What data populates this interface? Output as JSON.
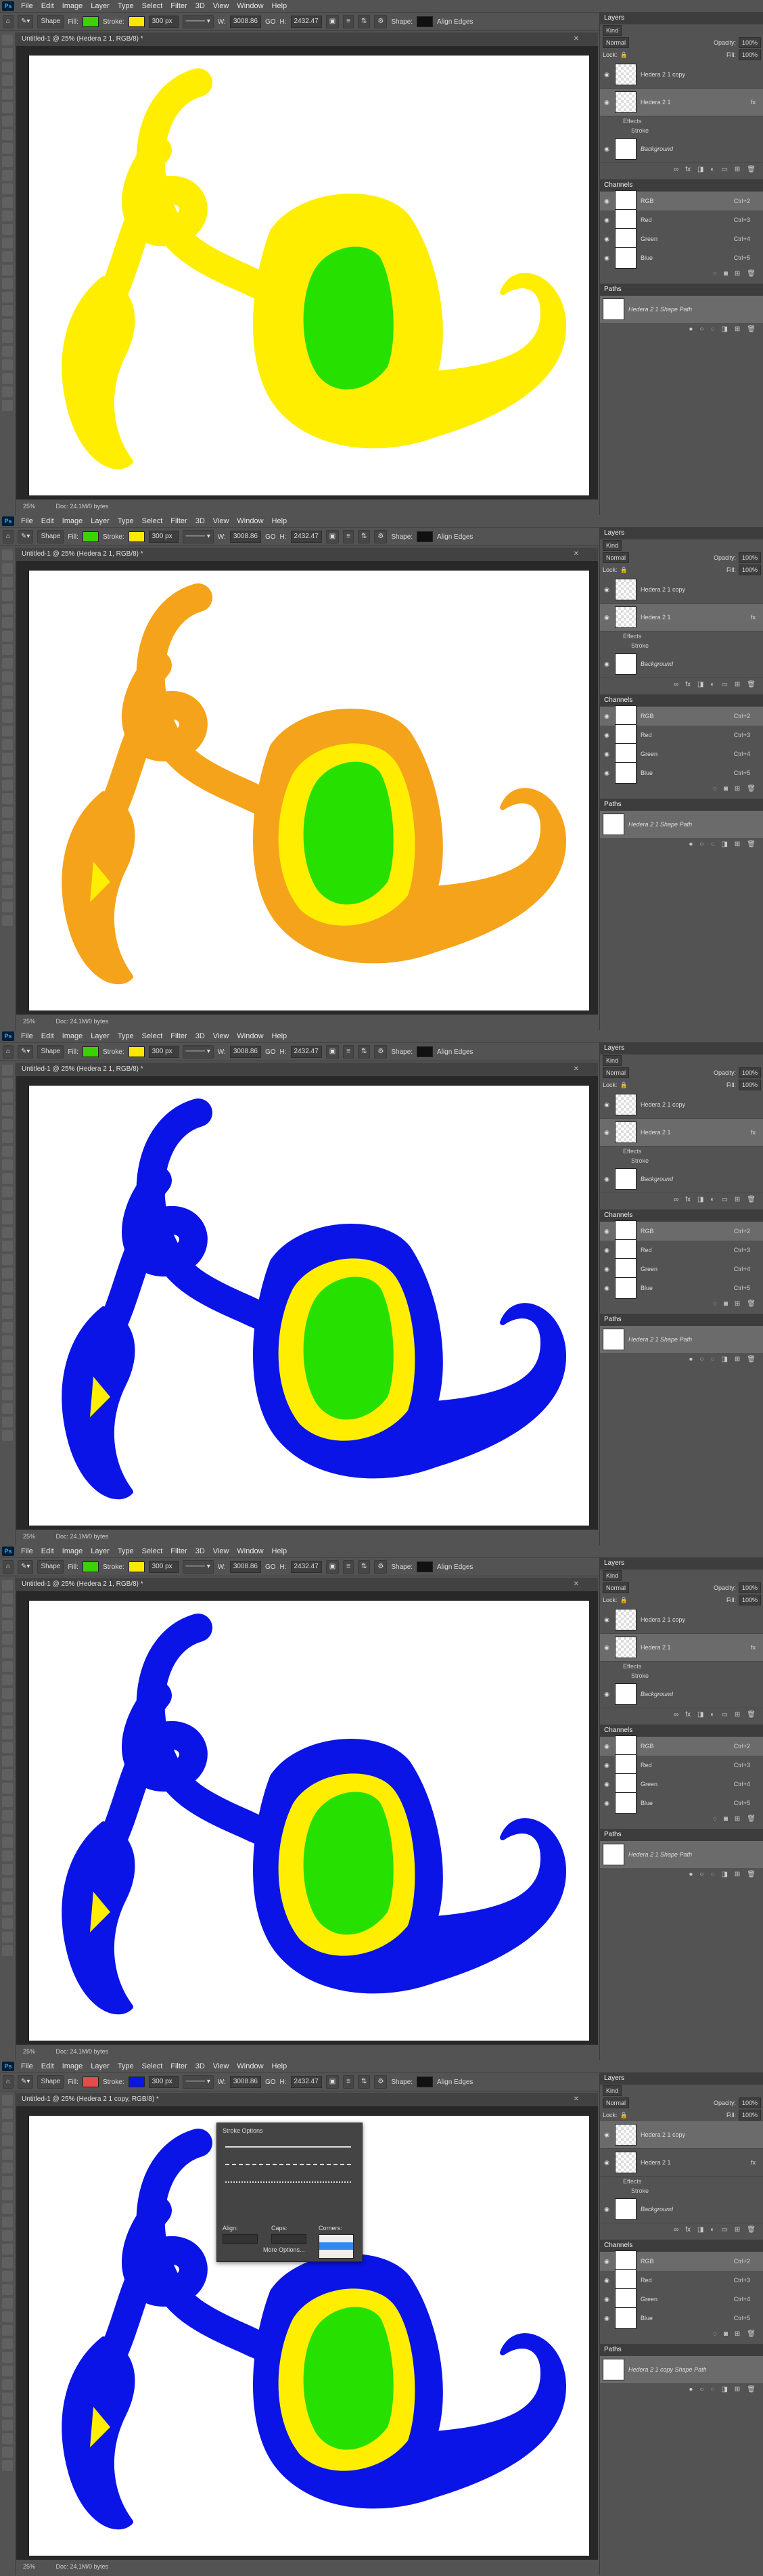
{
  "menu": [
    "File",
    "Edit",
    "Image",
    "Layer",
    "Type",
    "Select",
    "Filter",
    "3D",
    "View",
    "Window",
    "Help"
  ],
  "app_logo": "Ps",
  "options": {
    "mode": "Shape",
    "fill_label": "Fill:",
    "stroke_label": "Stroke:",
    "stroke_size": "300 px",
    "w_label": "W:",
    "w_value": "3008.86",
    "go_label": "GO",
    "h_label": "H:",
    "h_value": "2432.47",
    "shape_label": "Shape:",
    "align_edges": "Align Edges"
  },
  "frames": [
    {
      "doc_title": "Untitled-1 @ 25% (Hedera 2 1, RGB/8) *",
      "zoom": "25%",
      "doc_size": "Doc: 24.1M/0 bytes",
      "fill_color": "#3ad300",
      "stroke_color": "#ffe800",
      "outer": "#ffee00",
      "middle": "",
      "inner": "#26e000",
      "show_middle": false
    },
    {
      "doc_title": "Untitled-1 @ 25% (Hedera 2 1, RGB/8) *",
      "zoom": "25%",
      "doc_size": "Doc: 24.1M/0 bytes",
      "fill_color": "#3ad300",
      "stroke_color": "#ffe800",
      "outer": "#f5a31a",
      "middle": "#ffee00",
      "inner": "#26e000",
      "show_middle": true
    },
    {
      "doc_title": "Untitled-1 @ 25% (Hedera 2 1, RGB/8) *",
      "zoom": "25%",
      "doc_size": "Doc: 24.1M/0 bytes",
      "fill_color": "#3ad300",
      "stroke_color": "#ffe800",
      "outer": "#0a14e6",
      "middle": "#ffee00",
      "inner": "#26e000",
      "show_middle": true
    },
    {
      "doc_title": "Untitled-1 @ 25% (Hedera 2 1, RGB/8) *",
      "zoom": "25%",
      "doc_size": "Doc: 24.1M/0 bytes",
      "fill_color": "#3ad300",
      "stroke_color": "#ffe800",
      "outer": "#0a14e6",
      "middle": "#ffee00",
      "inner": "#26e000",
      "show_middle": true
    },
    {
      "doc_title": "Untitled-1 @ 25% (Hedera 2 1 copy, RGB/8) *",
      "zoom": "25%",
      "doc_size": "Doc: 24.1M/0 bytes",
      "fill_color": "#e84a4a",
      "stroke_color": "#0a14e6",
      "outer": "#0a14e6",
      "middle": "#ffee00",
      "inner": "#26e000",
      "show_middle": true
    }
  ],
  "layers_panel": {
    "title": "Layers",
    "kind_label": "Kind",
    "blend": "Normal",
    "opacity_label": "Opacity:",
    "opacity": "100%",
    "lock_label": "Lock:",
    "fill_label": "Fill:",
    "fill": "100%",
    "layers": [
      "Hedera 2 1 copy",
      "Hedera 2 1",
      "Background"
    ],
    "effects_label": "Effects",
    "stroke_effect": "Stroke",
    "fx": "fx"
  },
  "channels_panel": {
    "title": "Channels",
    "channels": [
      {
        "name": "RGB",
        "shortcut": "Ctrl+2"
      },
      {
        "name": "Red",
        "shortcut": "Ctrl+3"
      },
      {
        "name": "Green",
        "shortcut": "Ctrl+4"
      },
      {
        "name": "Blue",
        "shortcut": "Ctrl+5"
      }
    ]
  },
  "paths_panel": {
    "title": "Paths",
    "paths": [
      "Hedera 2 1 Shape Path",
      "Hedera 2 1 copy Shape Path"
    ]
  },
  "stroke_options": {
    "title": "Stroke Options",
    "align_label": "Align:",
    "caps_label": "Caps:",
    "corners_label": "Corners:",
    "more_options": "More Options..."
  }
}
